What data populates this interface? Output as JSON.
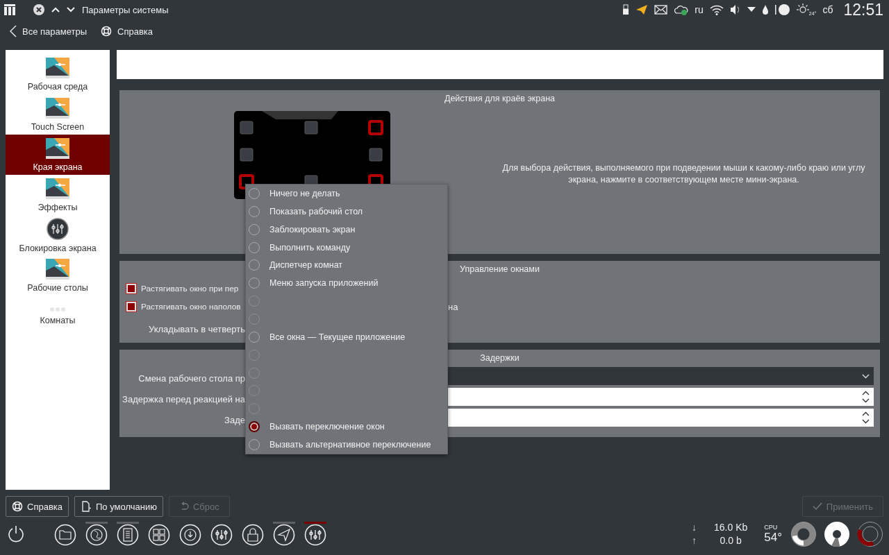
{
  "window": {
    "title": "Параметры системы"
  },
  "tray": {
    "language": "ru",
    "weather": "24°",
    "day": "сб",
    "clock": "12:51"
  },
  "nav": {
    "back": "Все параметры",
    "help": "Справка"
  },
  "sidebar": {
    "items": [
      {
        "label": "Рабочая среда",
        "kind": "wallpaper",
        "selected": false
      },
      {
        "label": "Touch Screen",
        "kind": "wallpaper",
        "selected": false
      },
      {
        "label": "Края экрана",
        "kind": "wallpaper",
        "selected": true
      },
      {
        "label": "Эффекты",
        "kind": "wallpaper",
        "selected": false
      },
      {
        "label": "Блокировка экрана",
        "kind": "sliders",
        "selected": false
      },
      {
        "label": "Рабочие столы",
        "kind": "wallpaper",
        "selected": false
      },
      {
        "label": "Комнаты",
        "kind": "dots",
        "selected": false
      }
    ]
  },
  "screen_edges": {
    "title": "Действия для краёв экрана",
    "edges": [
      {
        "active": false
      },
      {
        "active": false
      },
      {
        "active": true
      },
      {
        "active": false
      },
      {
        "active": false
      },
      {
        "active": true
      },
      {
        "active": false
      },
      {
        "active": true
      }
    ],
    "hint": "Для выбора действия, выполняемого при подведении мыши к какому-либо краю или углу экрана, нажмите в соответствующем месте мини-экрана."
  },
  "window_management": {
    "title": "Управление окнами",
    "options": [
      {
        "label": "Растягивать окно при пер",
        "checked": true
      },
      {
        "label": "Растягивать окно наполов",
        "checked": true,
        "tail": "на"
      }
    ],
    "quarter_label": "Укладывать в четверть"
  },
  "delays": {
    "title": "Задержки",
    "fields": [
      {
        "label": "Смена рабочего стола пр",
        "kind": "dropdown"
      },
      {
        "label": "Задержка перед реакцией на",
        "kind": "spin"
      },
      {
        "label": "Заде",
        "kind": "spin"
      }
    ]
  },
  "menu": {
    "items": [
      {
        "label": "Ничего не делать",
        "selected": false,
        "disabled": false
      },
      {
        "label": "Показать рабочий стол",
        "selected": false,
        "disabled": false
      },
      {
        "label": "Заблокировать экран",
        "selected": false,
        "disabled": false
      },
      {
        "label": "Выполнить команду",
        "selected": false,
        "disabled": false
      },
      {
        "label": "Диспетчер комнат",
        "selected": false,
        "disabled": false
      },
      {
        "label": "Меню запуска приложений",
        "selected": false,
        "disabled": false
      },
      {
        "selected": false,
        "disabled": true
      },
      {
        "selected": false,
        "disabled": true
      },
      {
        "label": "Все окна — Текущее приложение",
        "selected": false,
        "disabled": false
      },
      {
        "selected": false,
        "disabled": true
      },
      {
        "selected": false,
        "disabled": true
      },
      {
        "selected": false,
        "disabled": true
      },
      {
        "selected": false,
        "disabled": true
      },
      {
        "label": "Вызвать переключение окон",
        "selected": true,
        "disabled": false
      },
      {
        "label": "Вызвать альтернативное переключение",
        "selected": false,
        "disabled": false
      }
    ]
  },
  "buttons": [
    {
      "label": "Справка",
      "kind": "help",
      "disabled": false
    },
    {
      "label": "По умолчанию",
      "kind": "defaults",
      "disabled": false
    },
    {
      "label": "Сброс",
      "kind": "reset",
      "disabled": true
    }
  ],
  "apply": {
    "label": "Применить",
    "disabled": true
  },
  "taskbar": {
    "launchers": [
      {
        "kind": "folder",
        "running": false,
        "active": false
      },
      {
        "kind": "globe",
        "running": true,
        "active": false
      },
      {
        "kind": "document",
        "running": true,
        "active": false
      },
      {
        "kind": "grid",
        "running": false,
        "active": false
      },
      {
        "kind": "download",
        "running": false,
        "active": false
      },
      {
        "kind": "sliders",
        "running": false,
        "active": false
      },
      {
        "kind": "lock",
        "running": false,
        "active": false
      },
      {
        "kind": "send",
        "running": true,
        "active": false
      },
      {
        "kind": "sliders",
        "running": true,
        "active": true
      }
    ],
    "net_down": "↓",
    "net_down_value": "16.0 Kb",
    "net_up": "↑",
    "net_up_value": "0.0 b",
    "cpu_label": "CPU",
    "temperature": "54°"
  }
}
